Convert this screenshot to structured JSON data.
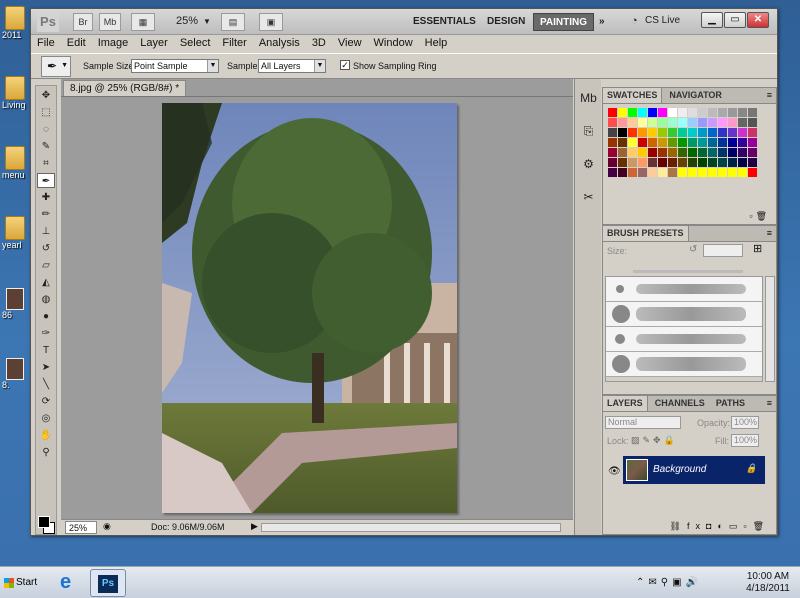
{
  "desktop": {
    "icons": [
      {
        "label": "2011",
        "type": "folder"
      },
      {
        "label": "Living",
        "type": "folder"
      },
      {
        "label": "menu",
        "type": "folder"
      },
      {
        "label": "yearl",
        "type": "folder"
      },
      {
        "label": "86",
        "type": "image"
      },
      {
        "label": "8.",
        "type": "image"
      }
    ]
  },
  "appbar": {
    "logo": "Ps",
    "bridge_btn": "Br",
    "minibridge_btn": "Mb",
    "zoom": "25%",
    "workspaces": [
      "ESSENTIALS",
      "DESIGN",
      "PAINTING"
    ],
    "active_workspace": "PAINTING",
    "more": "»",
    "cslive": "CS Live"
  },
  "menu": [
    "File",
    "Edit",
    "Image",
    "Layer",
    "Select",
    "Filter",
    "Analysis",
    "3D",
    "View",
    "Window",
    "Help"
  ],
  "options": {
    "sample_size_label": "Sample Size:",
    "sample_size_value": "Point Sample",
    "sample_label": "Sample:",
    "sample_value": "All Layers",
    "show_ring_label": "Show Sampling Ring",
    "show_ring_checked": true
  },
  "document": {
    "tab_title": "8.jpg @ 25% (RGB/8#) *",
    "zoom": "25%",
    "doc_size": "Doc: 9.06M/9.06M"
  },
  "panels": {
    "swatches_tab": "SWATCHES",
    "navigator_tab": "NAVIGATOR",
    "brush_presets_tab": "BRUSH PRESETS",
    "brush_size_label": "Size:",
    "layers_tab": "LAYERS",
    "channels_tab": "CHANNELS",
    "paths_tab": "PATHS",
    "blend_mode": "Normal",
    "opacity_label": "Opacity:",
    "opacity_value": "100%",
    "lock_label": "Lock:",
    "fill_label": "Fill:",
    "fill_value": "100%",
    "layer_name": "Background"
  },
  "swatch_colors": [
    "#ff0000",
    "#ffff00",
    "#00ff00",
    "#00ffff",
    "#0000ff",
    "#ff00ff",
    "#ffffff",
    "#eeeeee",
    "#dddddd",
    "#cccccc",
    "#bbbbbb",
    "#aaaaaa",
    "#999999",
    "#888888",
    "#777777",
    "#ff4d4d",
    "#ff9999",
    "#ffcc99",
    "#ffff99",
    "#ccff99",
    "#99ff99",
    "#99ffcc",
    "#99ffff",
    "#99ccff",
    "#9999ff",
    "#cc99ff",
    "#ff99ff",
    "#ff99cc",
    "#666666",
    "#555555",
    "#444444",
    "#000000",
    "#ff3300",
    "#ff9900",
    "#ffcc00",
    "#99cc00",
    "#33cc33",
    "#00cc99",
    "#00cccc",
    "#0099cc",
    "#0066cc",
    "#3333cc",
    "#6633cc",
    "#cc33cc",
    "#cc3366",
    "#993300",
    "#663300",
    "#ffff33",
    "#cc0000",
    "#cc6600",
    "#cc9900",
    "#669900",
    "#009900",
    "#009966",
    "#009999",
    "#006699",
    "#003399",
    "#000099",
    "#330099",
    "#990099",
    "#990033",
    "#996633",
    "#ffcc66",
    "#ffcc00",
    "#990000",
    "#993300",
    "#996600",
    "#336600",
    "#006600",
    "#006633",
    "#006666",
    "#003366",
    "#000066",
    "#330066",
    "#660066",
    "#660033",
    "#663300",
    "#cc9966",
    "#ff9966",
    "#663333",
    "#660000",
    "#662200",
    "#664400",
    "#224400",
    "#004400",
    "#004422",
    "#004444",
    "#002244",
    "#000044",
    "#220044",
    "#440044",
    "#440022",
    "#cc6633",
    "#996666",
    "#ffcc99",
    "#ffee99",
    "#aa7744",
    "#ffff00",
    "#ffff00",
    "#ffff00",
    "#ffff00",
    "#ffff00",
    "#ffff00",
    "#ffff00",
    "#ff0000"
  ],
  "taskbar": {
    "start": "Start",
    "time": "10:00 AM",
    "date": "4/18/2011"
  }
}
